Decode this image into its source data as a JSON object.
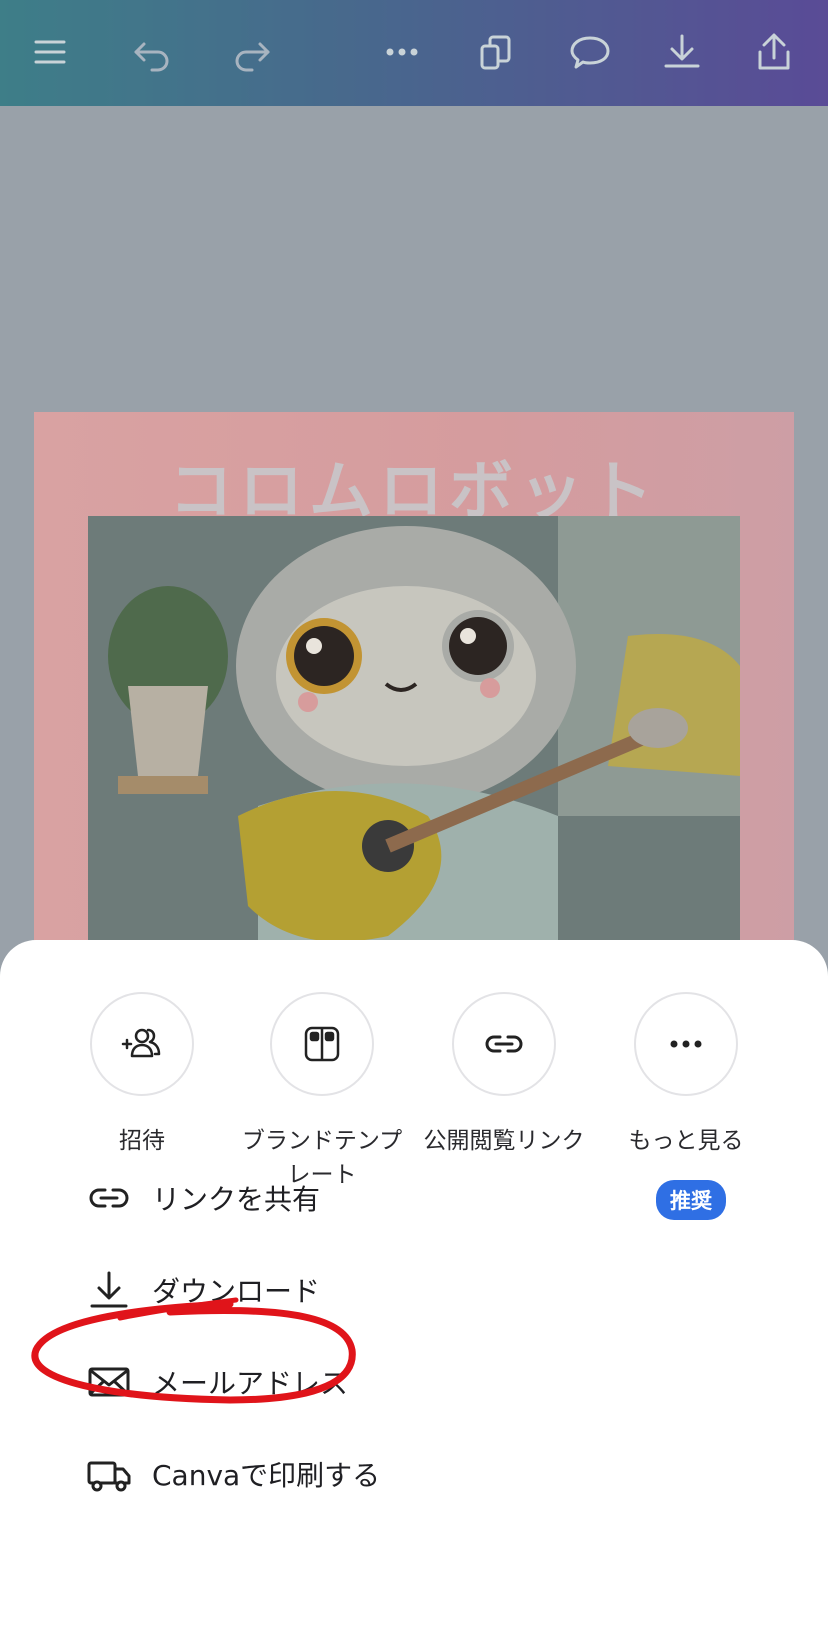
{
  "toolbar": {
    "icons": [
      "menu-icon",
      "undo-icon",
      "redo-icon",
      "more-icon",
      "pages-icon",
      "comment-icon",
      "download-icon",
      "share-icon"
    ]
  },
  "design": {
    "title": "コロムロボット"
  },
  "share_sheet": {
    "quick_actions": [
      {
        "label": "招待",
        "icon": "invite-icon"
      },
      {
        "label": "ブランドテンプレート",
        "icon": "brand-template-icon"
      },
      {
        "label": "公開閲覧リンク",
        "icon": "link-icon"
      },
      {
        "label": "もっと見る",
        "icon": "more-icon"
      }
    ],
    "options": [
      {
        "label": "リンクを共有",
        "icon": "link-icon",
        "badge": "推奨"
      },
      {
        "label": "ダウンロード",
        "icon": "download-icon"
      },
      {
        "label": "メールアドレス",
        "icon": "mail-icon"
      },
      {
        "label": "Canvaで印刷する",
        "icon": "truck-icon"
      }
    ]
  },
  "colors": {
    "toolbar_start": "#1f7d86",
    "toolbar_end": "#4a2f9c",
    "badge": "#2f6fe4",
    "annotation": "#e0141a"
  }
}
